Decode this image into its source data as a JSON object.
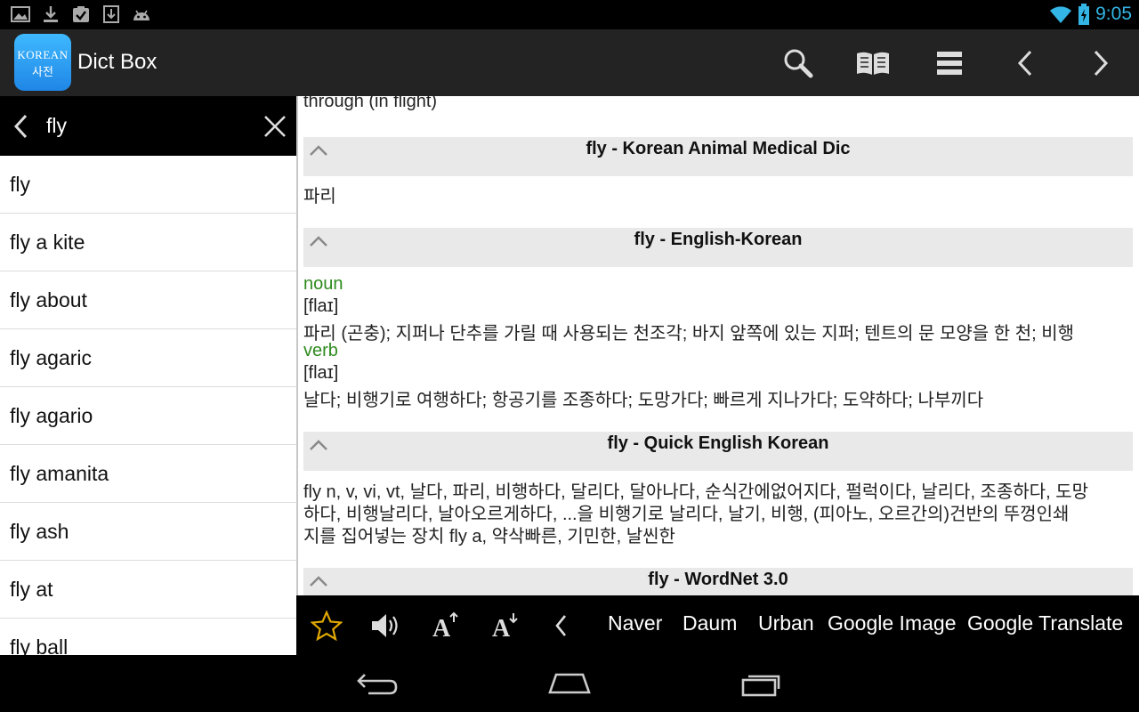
{
  "status_bar": {
    "time": "9:05",
    "left_icons": [
      "image-icon",
      "download-icon",
      "clipboard-check-icon",
      "download-box-icon",
      "android-icon"
    ],
    "right_icons": [
      "wifi-icon",
      "battery-icon"
    ],
    "accent": "#33b5e5"
  },
  "app": {
    "icon_line1": "KOREAN",
    "icon_line2": "사전",
    "title": "Dict Box"
  },
  "search": {
    "value": "fly"
  },
  "word_list": [
    "fly",
    "fly a kite",
    "fly about",
    "fly agaric",
    "fly agario",
    "fly amanita",
    "fly ash",
    "fly at",
    "fly ball"
  ],
  "content": {
    "top_line": "through (in flight)",
    "sections": [
      {
        "title": "fly - Korean Animal Medical Dic",
        "body": "파리"
      },
      {
        "title": "fly - English-Korean",
        "pos1": "noun",
        "pron1": "[flaɪ]",
        "def1": "파리 (곤충); 지퍼나 단추를 가릴 때 사용되는 천조각; 바지 앞쪽에 있는 지퍼; 텐트의 문 모양을 한 천; 비행",
        "pos2": "verb",
        "pron2": "[flaɪ]",
        "def2": "날다; 비행기로 여행하다; 항공기를 조종하다; 도망가다; 빠르게 지나가다; 도약하다; 나부끼다"
      },
      {
        "title": "fly - Quick English Korean",
        "line1": "fly n, v, vi, vt, 날다, 파리, 비행하다, 달리다, 달아나다, 순식간에없어지다, 펄럭이다, 날리다, 조종하다, 도망",
        "line2": "하다, 비행날리다, 날아오르게하다, ...을 비행기로 날리다, 날기, 비행, (피아노, 오르간의)건반의 뚜껑인쇄",
        "line3": "지를 집어넣는 장치 fly a, 약삭빠른, 기민한, 날씬한"
      },
      {
        "title": "fly - WordNet 3.0"
      }
    ],
    "pos_color": "#2e8b1e"
  },
  "toolbar": {
    "links": [
      "Naver",
      "Daum",
      "Urban",
      "Google Image",
      "Google Translate"
    ]
  }
}
